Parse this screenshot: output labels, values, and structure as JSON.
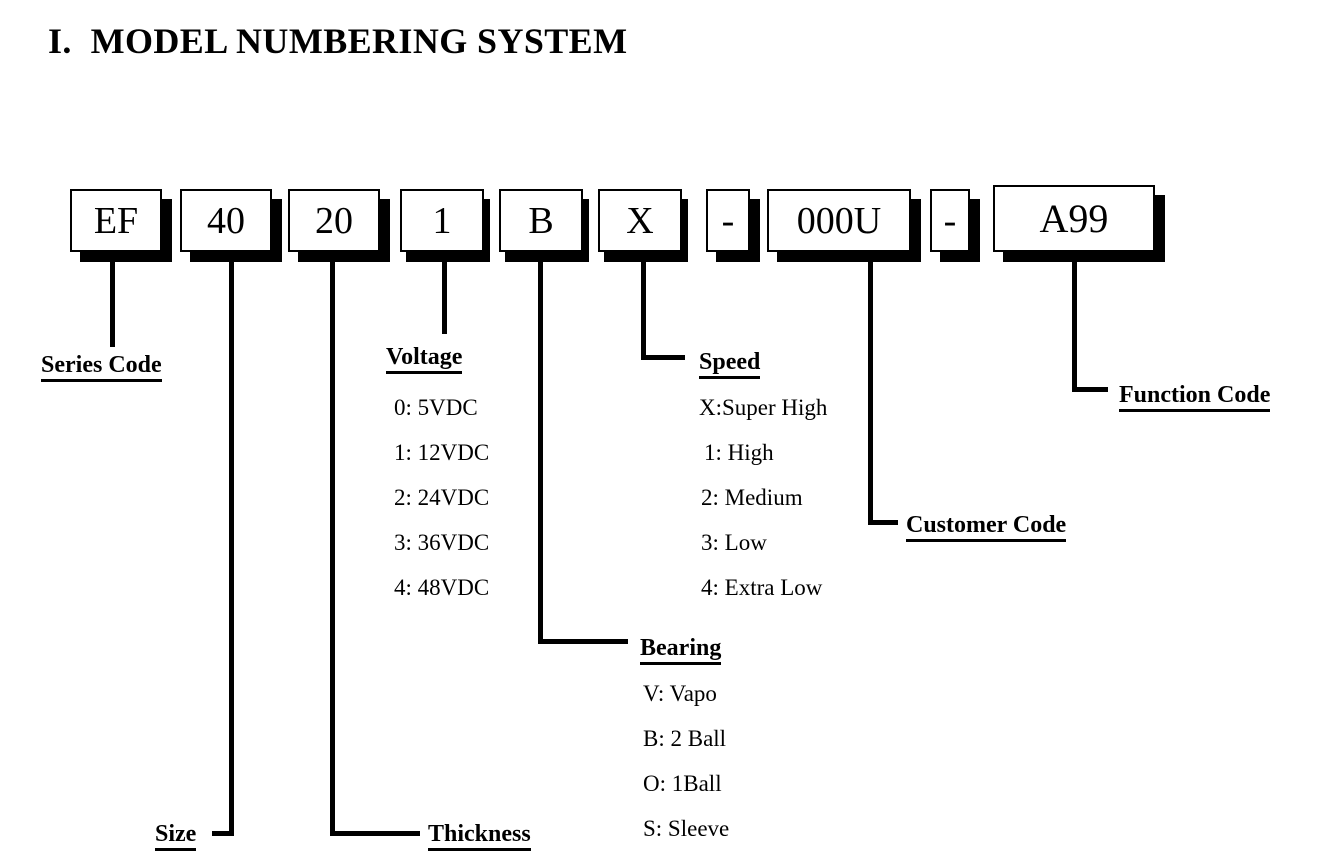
{
  "document": {
    "title": "I.  MODEL NUMBERING SYSTEM"
  },
  "model_code": {
    "segments": [
      {
        "name": "series",
        "value": "EF"
      },
      {
        "name": "size",
        "value": "40"
      },
      {
        "name": "thickness",
        "value": "20"
      },
      {
        "name": "voltage",
        "value": "1"
      },
      {
        "name": "bearing",
        "value": "B"
      },
      {
        "name": "speed",
        "value": "X"
      },
      {
        "name": "separator-1",
        "value": "-"
      },
      {
        "name": "customer",
        "value": "000U"
      },
      {
        "name": "separator-2",
        "value": "-"
      },
      {
        "name": "function",
        "value": "A99"
      }
    ]
  },
  "callouts": {
    "series_code": {
      "label": "Series Code"
    },
    "size": {
      "label": "Size"
    },
    "thickness": {
      "label": "Thickness"
    },
    "voltage": {
      "label": "Voltage",
      "options": [
        "0: 5VDC",
        "1: 12VDC",
        "2: 24VDC",
        "3: 36VDC",
        "4: 48VDC"
      ]
    },
    "bearing": {
      "label": "Bearing",
      "options": [
        "V: Vapo",
        "B: 2 Ball",
        "O: 1Ball",
        "S: Sleeve"
      ]
    },
    "speed": {
      "label": "Speed",
      "options": [
        "X:Super High",
        "1: High",
        "2: Medium",
        "3: Low",
        "4: Extra Low"
      ]
    },
    "customer_code": {
      "label": "Customer Code"
    },
    "function_code": {
      "label": "Function Code"
    }
  },
  "colors": {
    "ink": "#000000",
    "paper": "#ffffff"
  }
}
